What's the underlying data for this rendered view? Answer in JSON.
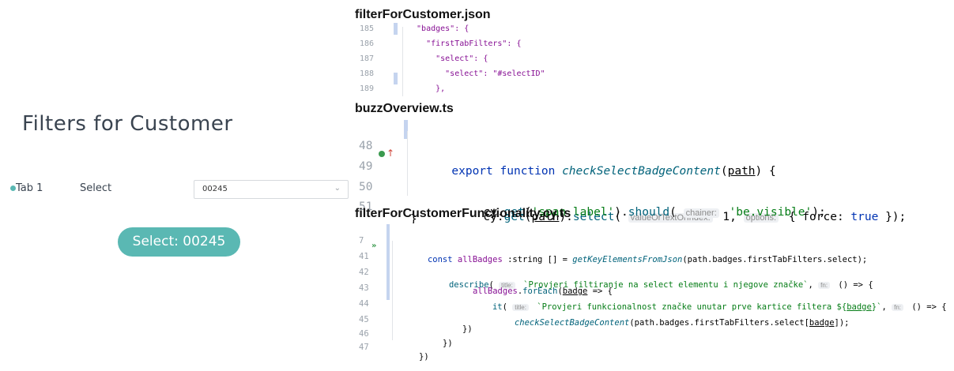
{
  "left_ui": {
    "title": "Filters for Customer",
    "tab_label": "Tab 1",
    "select_label": "Select",
    "select_value": "00245",
    "button_label": "Select: 00245",
    "accent_color": "#5ab8b3"
  },
  "panel1": {
    "file_title": "filterForCustomer.json",
    "lines": [
      {
        "n": "185",
        "t1": "  \"badges\": {"
      },
      {
        "n": "186",
        "t1": "    \"firstTabFilters\": {"
      },
      {
        "n": "187",
        "t1": "      \"select\": {"
      },
      {
        "n": "188",
        "t1": "        \"select\": \"#selectID\""
      },
      {
        "n": "189",
        "t1": "      },"
      }
    ]
  },
  "panel2": {
    "file_title": "buzzOverview.ts",
    "l48": {
      "n": "48",
      "kw1": "export ",
      "kw2": "function ",
      "fn": "checkSelectBadgeContent",
      "p1": "(",
      "arg": "path",
      "p2": ") {"
    },
    "l49": {
      "n": "49",
      "a": "cy.",
      "b": "get",
      "c": "(",
      "d": "path",
      "e": ").",
      "f": "select",
      "g": "( ",
      "h1": "valueOrTextOrIndex:",
      "v1": " 1, ",
      "h2": "options:",
      "v2": " { force: ",
      "v3": "true",
      "v4": " });"
    },
    "l50": {
      "n": "50",
      "a": "cy.",
      "b": "get",
      "c": "(",
      "d": "'span.label'",
      "e": ").",
      "f": "should",
      "g": "( ",
      "h1": "chainer:",
      "s": " 'be.visible'",
      "v": ");"
    },
    "l51": {
      "n": "51",
      "t": "}"
    }
  },
  "panel3": {
    "file_title": "filterForCustomerFunctionality.cy.ts",
    "l7": {
      "n": "7",
      "a": "const ",
      "b": "allBadges ",
      "c": ":string [] = ",
      "d": "getKeyElementsFromJson",
      "e": "(path.badges.firstTabFilters.select);"
    },
    "l41": {
      "n": "41",
      "a": "describe",
      "b": "( ",
      "h": "title:",
      "s": " `Provjeri filtiranje na select elementu i njegove značke`",
      "c": ", ",
      "h2": "fn:",
      "d": " () => {"
    },
    "l42": {
      "n": "42",
      "a": "allBadges",
      "b": ".",
      "c": "forEach",
      "d": "(",
      "e": "badge",
      "f": " => {"
    },
    "l43": {
      "n": "43",
      "a": "it",
      "b": "( ",
      "h": "title:",
      "s1": " `Provjeri funkcionalnost značke unutar prve kartice filtera ${",
      "u": "badge",
      "s2": "}`",
      "c": ", ",
      "h2": "fn:",
      "d": " () => {"
    },
    "l44": {
      "n": "44",
      "a": "checkSelectBadgeContent",
      "b": "(path.badges.firstTabFilters.select[",
      "u": "badge",
      "c": "]);"
    },
    "l45": {
      "n": "45",
      "t": "})"
    },
    "l46": {
      "n": "46",
      "t": "})"
    },
    "l47": {
      "n": "47",
      "t": "})"
    }
  }
}
